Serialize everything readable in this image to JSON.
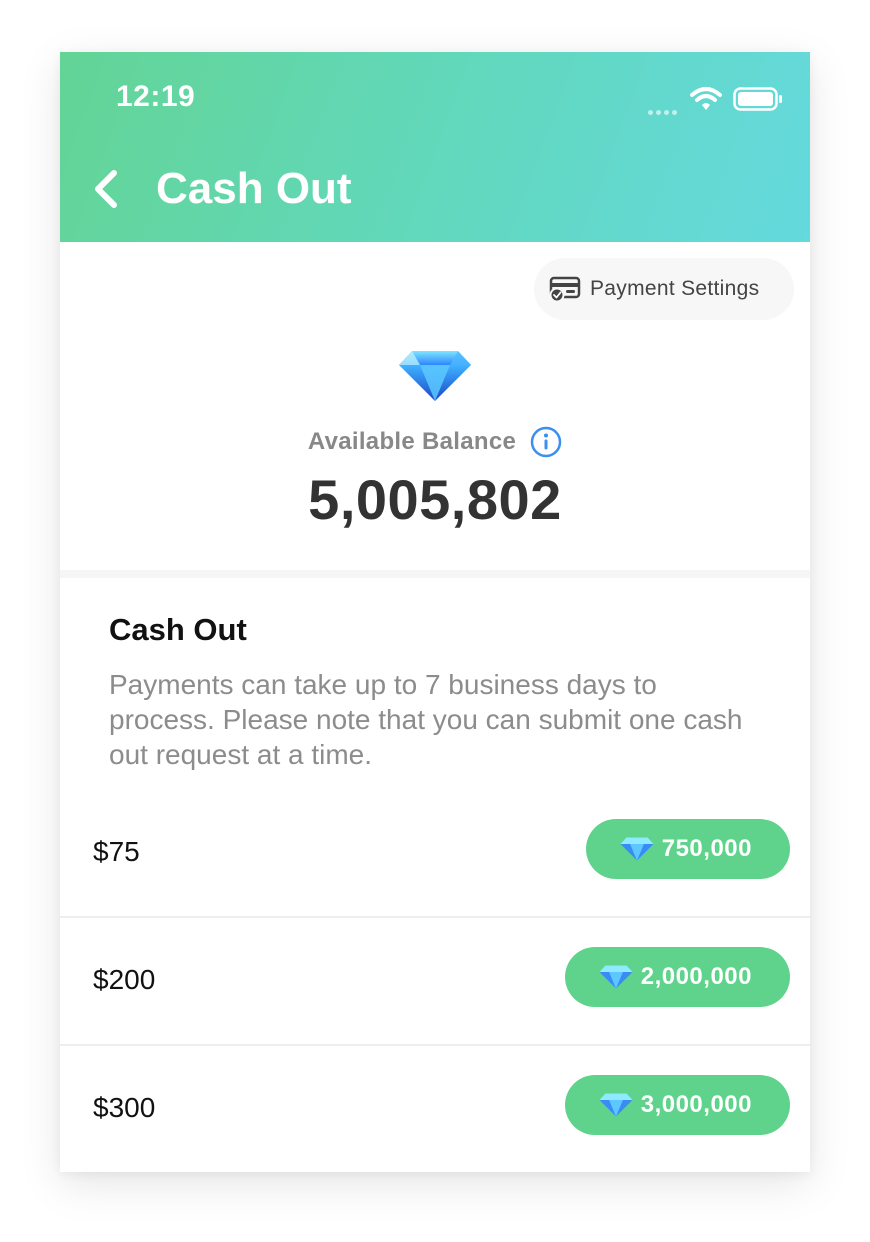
{
  "status_bar": {
    "time": "12:19"
  },
  "header": {
    "title": "Cash Out"
  },
  "payment_settings": {
    "label": "Payment Settings"
  },
  "balance": {
    "label": "Available Balance",
    "value": "5,005,802"
  },
  "section": {
    "title": "Cash Out",
    "description": "Payments can take up to 7 business days to process. Please note that you can submit one cash out request at a time."
  },
  "options": [
    {
      "amount": "$75",
      "diamonds": "750,000"
    },
    {
      "amount": "$200",
      "diamonds": "2,000,000"
    },
    {
      "amount": "$300",
      "diamonds": "3,000,000"
    }
  ],
  "colors": {
    "header_start": "#63d495",
    "header_end": "#64d9de",
    "pill_green": "#5fd38b",
    "info_blue": "#3b8ff0"
  }
}
